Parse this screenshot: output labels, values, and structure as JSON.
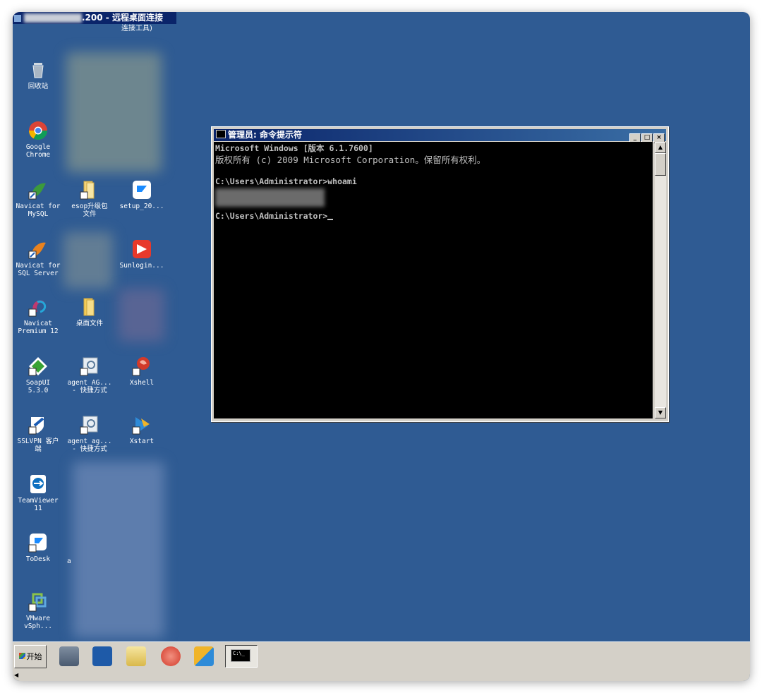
{
  "rdp": {
    "title_suffix": ".200 - 远程桌面连接",
    "subtitle": "连接工具)"
  },
  "desktop_icons": [
    {
      "id": "recycle",
      "label": "回收站",
      "icon": "recycle-bin-icon"
    },
    {
      "id": "chrome",
      "label": "Google\nChrome",
      "icon": "chrome-icon"
    },
    {
      "id": "navicat-mysql",
      "label": "Navicat for\nMySQL",
      "icon": "navicat-icon"
    },
    {
      "id": "esop",
      "label": "esop升级包\n文件",
      "icon": "folder-icon"
    },
    {
      "id": "setup",
      "label": "setup_20...",
      "icon": "todesk-icon"
    },
    {
      "id": "navicat-sql",
      "label": "Navicat for\nSQL Server",
      "icon": "navicat-icon"
    },
    {
      "id": "sunlogin",
      "label": "Sunlogin...",
      "icon": "sunlogin-icon"
    },
    {
      "id": "navicat-premium",
      "label": "Navicat\nPremium 12",
      "icon": "navicat-premium-icon"
    },
    {
      "id": "desktop-files",
      "label": "桌面文件",
      "icon": "folder-icon"
    },
    {
      "id": "soapui",
      "label": "SoapUI\n5.3.0",
      "icon": "soapui-icon"
    },
    {
      "id": "agent1",
      "label": "agent_AG...\n- 快捷方式",
      "icon": "shortcut-icon"
    },
    {
      "id": "xshell",
      "label": "Xshell",
      "icon": "xshell-icon"
    },
    {
      "id": "sslvpn",
      "label": "SSLVPN 客户\n端",
      "icon": "vpn-icon"
    },
    {
      "id": "agent2",
      "label": "agent_ag...\n- 快捷方式",
      "icon": "shortcut-icon"
    },
    {
      "id": "xstart",
      "label": "Xstart",
      "icon": "xstart-icon"
    },
    {
      "id": "teamviewer",
      "label": "TeamViewer\n11",
      "icon": "teamviewer-icon"
    },
    {
      "id": "todesk",
      "label": "ToDesk",
      "icon": "todesk-icon"
    },
    {
      "id": "todesk-partial",
      "label": "a",
      "icon": ""
    },
    {
      "id": "vmware",
      "label": "VMware\nvSph...",
      "icon": "vmware-icon"
    }
  ],
  "cmd": {
    "title": "管理员: 命令提示符",
    "lines": [
      "Microsoft Windows [版本 6.1.7600]",
      "版权所有 (c) 2009 Microsoft Corporation。保留所有权利。",
      "",
      "C:\\Users\\Administrator>whoami"
    ],
    "prompt": "C:\\Users\\Administrator>",
    "buttons": {
      "min": "_",
      "max": "□",
      "close": "×"
    }
  },
  "taskbar": {
    "start_label": "开始",
    "mini_console_text": "C:\\_"
  },
  "colors": {
    "desktop": "#2f5b93",
    "titlebar": "#0a246a",
    "console_bg": "#000000",
    "console_fg": "#c0c0c0"
  }
}
